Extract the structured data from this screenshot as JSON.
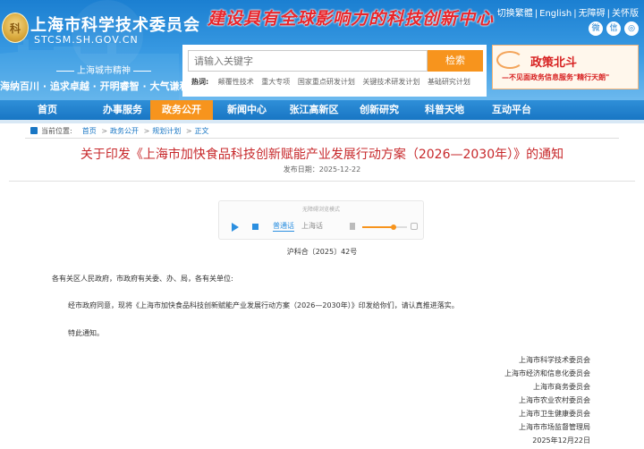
{
  "header": {
    "emblem_char": "科",
    "site_title": "上海市科学技术委员会",
    "site_domain": "STCSM.SH.GOV.CN",
    "slogan": "建设具有全球影响力的科技创新中心",
    "spirit_label": "上海城市精神",
    "spirit_text": "海纳百川 · 追求卓越 · 开明睿智 · 大气谦和",
    "top_links": [
      "切换繁體",
      "English",
      "无障碍",
      "关怀版"
    ],
    "social_icons": [
      "weibo-icon",
      "wechat-icon",
      "app-icon"
    ]
  },
  "search": {
    "placeholder": "请输入关键字",
    "button_label": "检索",
    "hot_label": "热词:",
    "hot_words": [
      "颠覆性技术",
      "重大专项",
      "国家重点研发计划",
      "关键技术研发计划",
      "基础研究计划"
    ]
  },
  "banner": {
    "title": "政策北斗",
    "subtitle": "—不见面政务信息服务\"精行天朗\""
  },
  "nav": {
    "items": [
      "首页",
      "办事服务",
      "政务公开",
      "新闻中心",
      "张江高新区",
      "创新研究",
      "科普天地",
      "互动平台"
    ],
    "active_index": 2
  },
  "breadcrumb": {
    "label": "当前位置:",
    "items": [
      "首页",
      "政务公开",
      "规划计划",
      "正文"
    ]
  },
  "article": {
    "title": "关于印发《上海市加快食品科技创新赋能产业发展行动方案（2026—2030年）》的通知",
    "pubdate": "发布日期：2025-12-22",
    "doc_number": "沪科合〔2025〕42号",
    "salutation": "各有关区人民政府，市政府有关委、办、局，各有关单位:",
    "paragraph1": "经市政府同意，现将《上海市加快食品科技创新赋能产业发展行动方案（2026—2030年）》印发给你们，请认真推进落实。",
    "paragraph2": "特此通知。",
    "signatures": [
      "上海市科学技术委员会",
      "上海市经济和信息化委员会",
      "上海市商务委员会",
      "上海市农业农村委员会",
      "上海市卫生健康委员会",
      "上海市市场监督管理局"
    ],
    "sign_date": "2025年12月22日"
  },
  "player": {
    "accessible_label": "无障碍浏览模式",
    "lang_a": "普通话",
    "lang_b": "上海话",
    "volume_level": 0.7
  },
  "colors": {
    "header_blue": "#1b7fd1",
    "nav_active": "#f7941d",
    "title_red": "#c7282b",
    "search_button": "#f7941d"
  }
}
